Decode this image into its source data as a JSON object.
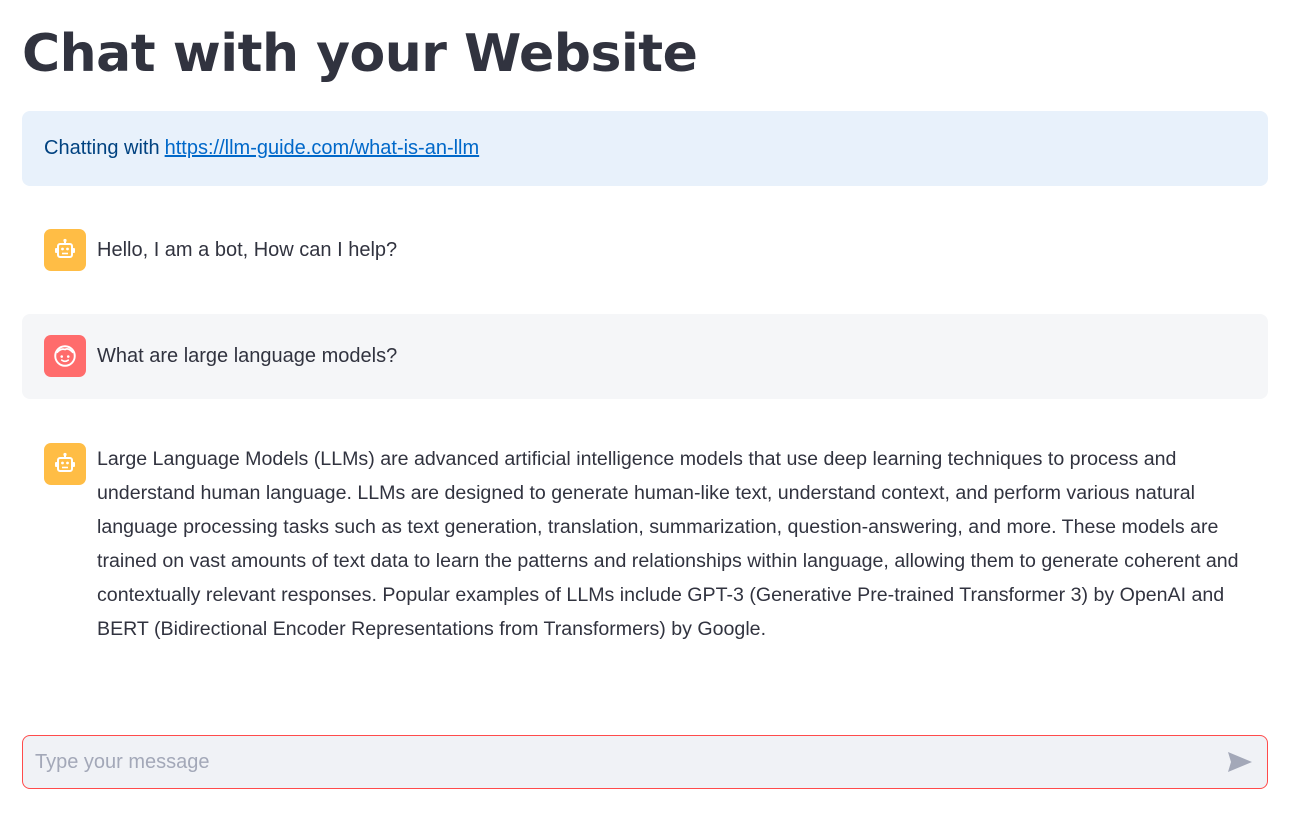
{
  "header": {
    "title": "Chat with your Website"
  },
  "info": {
    "prefix": "Chatting with",
    "url": "https://llm-guide.com/what-is-an-llm"
  },
  "messages": [
    {
      "role": "assistant",
      "avatar_icon": "robot-icon",
      "text": "Hello, I am a bot, How can I help?"
    },
    {
      "role": "user",
      "avatar_icon": "user-face-icon",
      "text": "What are large language models?"
    },
    {
      "role": "assistant",
      "avatar_icon": "robot-icon",
      "text": "Large Language Models (LLMs) are advanced artificial intelligence models that use deep learning techniques to process and understand human language. LLMs are designed to generate human-like text, understand context, and perform various natural language processing tasks such as text generation, translation, summarization, question-answering, and more. These models are trained on vast amounts of text data to learn the patterns and relationships within language, allowing them to generate coherent and contextually relevant responses. Popular examples of LLMs include GPT-3 (Generative Pre-trained Transformer 3) by OpenAI and BERT (Bidirectional Encoder Representations from Transformers) by Google."
    }
  ],
  "chat_input": {
    "placeholder": "Type your message",
    "value": "",
    "send_icon": "send-icon"
  },
  "colors": {
    "bot_avatar": "#ffbd45",
    "user_avatar": "#ff6c6c",
    "info_background": "#e8f1fb",
    "link": "#0068c9",
    "input_border_focus": "#ff4b4b"
  }
}
